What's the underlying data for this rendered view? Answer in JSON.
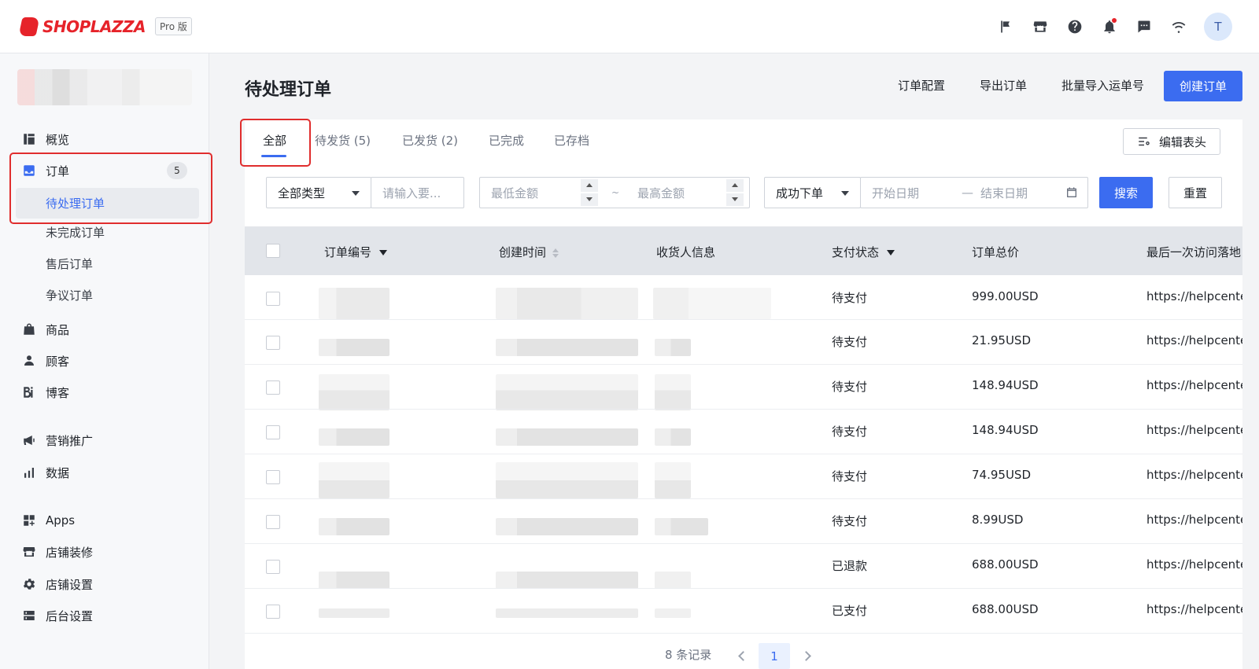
{
  "header": {
    "logo_text": "SHOPLAZZA",
    "plan_badge": "Pro 版",
    "avatar_initial": "T"
  },
  "sidebar": {
    "items": [
      {
        "label": "概览",
        "icon": "dashboard-icon"
      },
      {
        "label": "订单",
        "icon": "inbox-icon",
        "badge": "5"
      },
      {
        "label": "商品",
        "icon": "bag-icon"
      },
      {
        "label": "顾客",
        "icon": "person-icon"
      },
      {
        "label": "博客",
        "icon": "blog-icon"
      },
      {
        "label": "营销推广",
        "icon": "megaphone-icon"
      },
      {
        "label": "数据",
        "icon": "bar-chart-icon"
      },
      {
        "label": "Apps",
        "icon": "apps-icon"
      },
      {
        "label": "店铺装修",
        "icon": "store-icon"
      },
      {
        "label": "店铺设置",
        "icon": "gear-icon"
      },
      {
        "label": "后台设置",
        "icon": "server-icon"
      }
    ],
    "order_sub_items": [
      "待处理订单",
      "未完成订单",
      "售后订单",
      "争议订单"
    ]
  },
  "page": {
    "title": "待处理订单",
    "actions": {
      "order_config": "订单配置",
      "export_orders": "导出订单",
      "bulk_import": "批量导入运单号",
      "create_order": "创建订单"
    }
  },
  "tabs": [
    "全部",
    "待发货 (5)",
    "已发货 (2)",
    "已完成",
    "已存档"
  ],
  "edit_columns_label": "编辑表头",
  "filters": {
    "type_select": "全部类型",
    "keyword_placeholder": "请输入要...",
    "min_amount_placeholder": "最低金额",
    "range_sep": "~",
    "max_amount_placeholder": "最高金额",
    "date_type_select": "成功下单",
    "start_date_placeholder": "开始日期",
    "date_sep": "—",
    "end_date_placeholder": "结束日期",
    "search_label": "搜索",
    "reset_label": "重置"
  },
  "table": {
    "columns": [
      "订单编号",
      "创建时间",
      "收货人信息",
      "支付状态",
      "订单总价",
      "最后一次访问落地"
    ],
    "rows": [
      {
        "status": "待支付",
        "total": "999.00USD",
        "landing": "https://helpcente"
      },
      {
        "status": "待支付",
        "total": "21.95USD",
        "landing": "https://helpcente"
      },
      {
        "status": "待支付",
        "total": "148.94USD",
        "landing": "https://helpcente"
      },
      {
        "status": "待支付",
        "total": "148.94USD",
        "landing": "https://helpcente"
      },
      {
        "status": "待支付",
        "total": "74.95USD",
        "landing": "https://helpcente"
      },
      {
        "status": "待支付",
        "total": "8.99USD",
        "landing": "https://helpcente"
      },
      {
        "status": "已退款",
        "total": "688.00USD",
        "landing": "https://helpcente"
      },
      {
        "status": "已支付",
        "total": "688.00USD",
        "landing": "https://helpcente"
      }
    ]
  },
  "pagination": {
    "records": "8 条记录",
    "current_page": "1"
  },
  "colors": {
    "primary": "#3b6cf0",
    "brand_red": "#e6232a",
    "highlight_red": "#e02d2d"
  }
}
